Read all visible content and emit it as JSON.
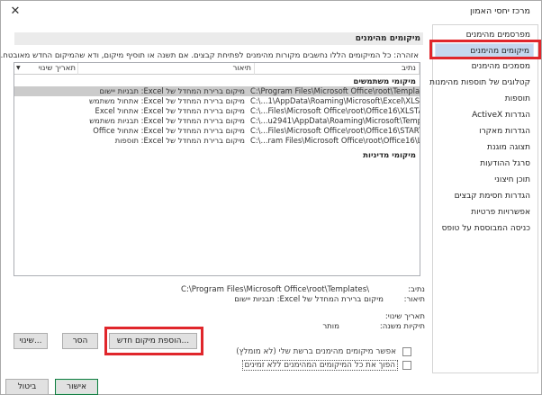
{
  "window": {
    "title": "מרכז יחסי האמון",
    "close_glyph": "✕"
  },
  "nav": {
    "items": [
      {
        "label": "מפרסמים מהימנים"
      },
      {
        "label": "מיקומים מהימנים",
        "selected": true
      },
      {
        "label": "מסמכים מהימנים"
      },
      {
        "label": "קטלוגים של תוספות מהימנות"
      },
      {
        "label": "תוספות"
      },
      {
        "label": "הגדרות ActiveX"
      },
      {
        "label": "הגדרות מאקרו"
      },
      {
        "label": "תצוגה מוגנת"
      },
      {
        "label": "סרגל ההודעות"
      },
      {
        "label": "תוכן חיצוני"
      },
      {
        "label": "הגדרות חסימת קבצים"
      },
      {
        "label": "אפשרויות פרטיות"
      },
      {
        "label": "כניסה המבוססת על טופס"
      }
    ]
  },
  "main": {
    "section_title": "מיקומים מהימנים",
    "warning": "אזהרה: כל המיקומים הללו נחשבים מקורות מהימנים לפתיחת קבצים. אם תשנה או תוסיף מיקום, ודא שהמיקום החדש מאובטח.",
    "columns": {
      "path": "נתיב",
      "description": "תיאור",
      "date": "תאריך שינוי"
    },
    "date_sort_glyph": "▼",
    "user_locations_header": "מיקומי משתמשים",
    "user_locations": [
      {
        "path": "C:\\Program Files\\Microsoft Office\\root\\Templates\\",
        "description": "מיקום ברירת המחדל של Excel: תבניות יישום",
        "selected": true
      },
      {
        "path": "C:\\...1\\AppData\\Roaming\\Microsoft\\Excel\\XLSTART\\",
        "description": "מיקום ברירת המחדל של Excel: אתחול משתמש"
      },
      {
        "path": "C:\\...Files\\Microsoft Office\\root\\Office16\\XLSTART\\",
        "description": "מיקום ברירת המחדל של Excel: אתחול Excel"
      },
      {
        "path": "C:\\...u2941\\AppData\\Roaming\\Microsoft\\Templates\\",
        "description": "מיקום ברירת המחדל של Excel: תבניות משתמש"
      },
      {
        "path": "C:\\...Files\\Microsoft Office\\root\\Office16\\STARTUP\\",
        "description": "מיקום ברירת המחדל של Excel: אתחול Office"
      },
      {
        "path": "C:\\...ram Files\\Microsoft Office\\root\\Office16\\Library\\",
        "description": "מיקום ברירת המחדל של Excel: תוספות"
      }
    ],
    "policy_locations_header": "מיקומי מדיניות",
    "details": {
      "path_label": "נתיב:",
      "path_value": "C:\\Program Files\\Microsoft Office\\root\\Templates\\",
      "description_label": "תיאור:",
      "description_value": "מיקום ברירת המחדל של Excel: תבניות יישום",
      "date_label": "תאריך שינוי:",
      "date_value": "",
      "subfolders_label": "תיקיות משנה:",
      "subfolders_value": "מותר"
    },
    "buttons": {
      "add": "הוספת מיקום חדש...",
      "remove": "הסר",
      "modify": "שינוי..."
    },
    "checkboxes": {
      "allow_network": "אפשר מיקומים מהימנים ברשת שלי (לא מומלץ)",
      "disable_all": "הפוך את כל המיקומים המהימנים ללא זמינים"
    }
  },
  "footer": {
    "ok": "אישור",
    "cancel": "ביטול"
  },
  "colors": {
    "highlight": "#e0262b",
    "selected_nav": "#c5d8ef",
    "ok_border": "#0f7a3f"
  }
}
